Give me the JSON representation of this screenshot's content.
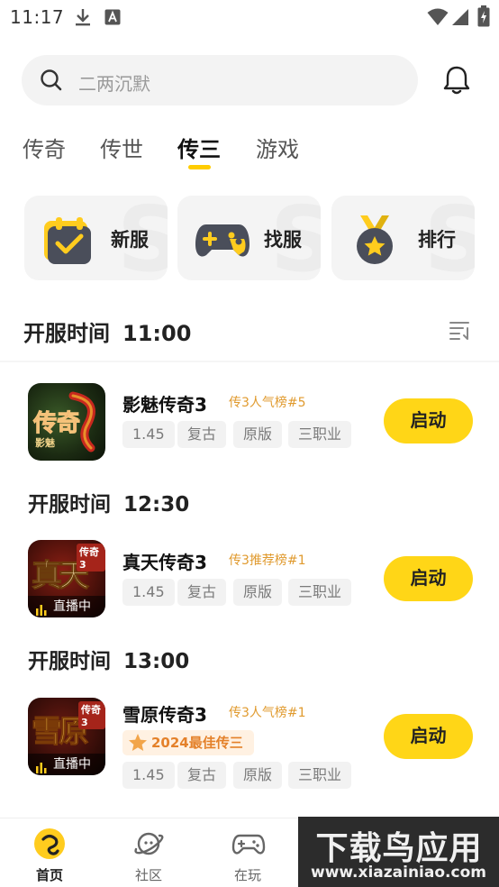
{
  "status_bar": {
    "time": "11:17"
  },
  "search": {
    "placeholder": "二两沉默"
  },
  "tabs": [
    {
      "label": "传奇"
    },
    {
      "label": "传世"
    },
    {
      "label": "传三"
    },
    {
      "label": "游戏"
    }
  ],
  "active_tab": "传三",
  "quick_actions": [
    {
      "label": "新服",
      "icon": "calendar-check-icon"
    },
    {
      "label": "找服",
      "icon": "gamepad-icon"
    },
    {
      "label": "排行",
      "icon": "medal-icon"
    }
  ],
  "section": {
    "title": "开服时间",
    "time": "11:00"
  },
  "games": [
    {
      "name": "影魅传奇3",
      "rank": "传3人气榜#5",
      "tags": [
        "1.45",
        "复古",
        "原版",
        "三职业"
      ],
      "icon_text": "传奇",
      "icon_sub": "影魅",
      "button": "启动"
    },
    {
      "time_header": {
        "title": "开服时间",
        "time": "12:30"
      },
      "name": "真天传奇3",
      "rank": "传3推荐榜#1",
      "tags": [
        "1.45",
        "复古",
        "原版",
        "三职业"
      ],
      "icon_text": "真天",
      "icon_corner": "传奇3",
      "live": "直播中",
      "button": "启动"
    },
    {
      "time_header": {
        "title": "开服时间",
        "time": "13:00"
      },
      "name": "雪原传奇3",
      "rank": "传3人气榜#1",
      "award": "2024最佳传三",
      "tags": [
        "1.45",
        "复古",
        "原版",
        "三职业"
      ],
      "icon_text": "雪原",
      "icon_corner": "传奇3",
      "live": "直播中",
      "button": "启动"
    }
  ],
  "bottom_nav": [
    {
      "label": "首页",
      "icon": "home-icon"
    },
    {
      "label": "社区",
      "icon": "planet-icon"
    },
    {
      "label": "在玩",
      "icon": "controller-icon"
    }
  ],
  "watermark": {
    "line1": "下载鸟应用",
    "line2": "www.xiazainiao.com"
  },
  "colors": {
    "accent": "#ffd617",
    "rank": "#e09a2e",
    "award": "#e4812a"
  }
}
